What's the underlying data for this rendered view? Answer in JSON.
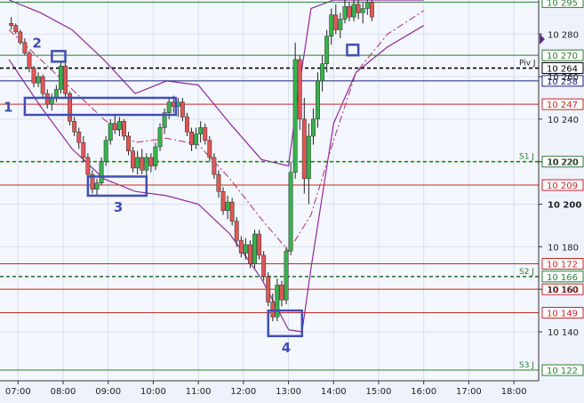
{
  "chart_data": {
    "type": "line",
    "subtype": "candlestick-with-bollinger-bands",
    "title": "",
    "xlabel": "",
    "ylabel": "",
    "x_ticks": [
      "07:00",
      "08:00",
      "09:00",
      "10:00",
      "11:00",
      "12:00",
      "13:00",
      "14:00",
      "15:00",
      "16:00",
      "17:00",
      "18:00"
    ],
    "y_ticks": [
      10140,
      10160,
      10180,
      10200,
      10220,
      10240,
      10260,
      10280
    ],
    "y_tick_labels": [
      "10 140",
      "10 160",
      "10 180",
      "10 200",
      "10 220",
      "10 240",
      "10 260",
      "10 280"
    ],
    "ylim": [
      10117,
      10296
    ],
    "levels": [
      {
        "label": "10 295",
        "value": 10295,
        "color": "#2e7d32",
        "style": "solid"
      },
      {
        "label": "10 270",
        "value": 10270,
        "color": "#2e7d32",
        "style": "solid"
      },
      {
        "label": "10 264",
        "value": 10264,
        "color": "#000000",
        "style": "dashed",
        "name": "Piv J"
      },
      {
        "label": "10 258",
        "value": 10258,
        "color": "#1a237e",
        "style": "solid"
      },
      {
        "label": "10 247",
        "value": 10247,
        "color": "#c62828",
        "style": "solid"
      },
      {
        "label": "10 220",
        "value": 10220,
        "color": "#2e7d32",
        "style": "dashed",
        "name": "S1 J"
      },
      {
        "label": "10 209",
        "value": 10209,
        "color": "#c62828",
        "style": "solid"
      },
      {
        "label": "10 172",
        "value": 10172,
        "color": "#c62828",
        "style": "solid"
      },
      {
        "label": "10 166",
        "value": 10166,
        "color": "#2e7d32",
        "style": "dashed",
        "name": "S2 J"
      },
      {
        "label": "10 160",
        "value": 10160,
        "color": "#c62828",
        "style": "solid"
      },
      {
        "label": "10 149",
        "value": 10149,
        "color": "#c62828",
        "style": "solid"
      },
      {
        "label": "10 122",
        "value": 10122,
        "color": "#2e7d32",
        "style": "solid",
        "name": "S3 J"
      }
    ],
    "series": [
      {
        "values_time": [
          6.8,
          7.0,
          7.2,
          7.4,
          7.6,
          7.8,
          8.0,
          8.2,
          8.4,
          8.6,
          8.8,
          9.0,
          9.2,
          9.4,
          9.6,
          9.8,
          10.0,
          10.2,
          10.4,
          10.6,
          10.8,
          11.0,
          11.2,
          11.4,
          11.6,
          11.8,
          12.0,
          12.2,
          12.4,
          12.6,
          12.8,
          13.0,
          13.2,
          13.4,
          13.6,
          13.8,
          14.0,
          14.2,
          14.4,
          14.6,
          14.8,
          15.0,
          15.2,
          15.4,
          15.6,
          15.8,
          16.0,
          16.2,
          16.4,
          16.6,
          16.8,
          17.0,
          17.2,
          17.4,
          17.6,
          17.8,
          18.0,
          18.2,
          18.4
        ]
      }
    ],
    "candles": [
      [
        6.85,
        10285,
        10288,
        10282,
        10284
      ],
      [
        6.95,
        10284,
        10285,
        10280,
        10281
      ],
      [
        7.05,
        10281,
        10282,
        10275,
        10276
      ],
      [
        7.15,
        10276,
        10278,
        10270,
        10271
      ],
      [
        7.25,
        10271,
        10272,
        10262,
        10264
      ],
      [
        7.35,
        10264,
        10265,
        10255,
        10257
      ],
      [
        7.45,
        10257,
        10262,
        10255,
        10260
      ],
      [
        7.55,
        10260,
        10261,
        10250,
        10252
      ],
      [
        7.65,
        10252,
        10254,
        10245,
        10247
      ],
      [
        7.75,
        10247,
        10252,
        10244,
        10250
      ],
      [
        7.85,
        10250,
        10256,
        10248,
        10254
      ],
      [
        7.95,
        10254,
        10267,
        10252,
        10265
      ],
      [
        8.05,
        10265,
        10267,
        10250,
        10252
      ],
      [
        8.15,
        10252,
        10253,
        10237,
        10239
      ],
      [
        8.25,
        10239,
        10241,
        10232,
        10234
      ],
      [
        8.35,
        10234,
        10236,
        10226,
        10229
      ],
      [
        8.45,
        10229,
        10232,
        10220,
        10222
      ],
      [
        8.55,
        10222,
        10224,
        10212,
        10214
      ],
      [
        8.65,
        10214,
        10216,
        10205,
        10207
      ],
      [
        8.75,
        10207,
        10212,
        10204,
        10210
      ],
      [
        8.85,
        10210,
        10222,
        10209,
        10220
      ],
      [
        8.95,
        10220,
        10232,
        10218,
        10230
      ],
      [
        9.05,
        10230,
        10240,
        10228,
        10238
      ],
      [
        9.15,
        10238,
        10242,
        10233,
        10235
      ],
      [
        9.25,
        10235,
        10241,
        10232,
        10239
      ],
      [
        9.35,
        10239,
        10240,
        10230,
        10232
      ],
      [
        9.45,
        10232,
        10234,
        10223,
        10225
      ],
      [
        9.55,
        10225,
        10227,
        10215,
        10217
      ],
      [
        9.65,
        10217,
        10225,
        10214,
        10222
      ],
      [
        9.75,
        10222,
        10226,
        10214,
        10216
      ],
      [
        9.85,
        10216,
        10224,
        10212,
        10222
      ],
      [
        9.95,
        10222,
        10224,
        10215,
        10218
      ],
      [
        10.05,
        10218,
        10229,
        10216,
        10227
      ],
      [
        10.15,
        10227,
        10238,
        10225,
        10236
      ],
      [
        10.25,
        10236,
        10245,
        10233,
        10243
      ],
      [
        10.35,
        10243,
        10250,
        10240,
        10248
      ],
      [
        10.45,
        10248,
        10251,
        10243,
        10246
      ],
      [
        10.55,
        10246,
        10250,
        10241,
        10248
      ],
      [
        10.65,
        10248,
        10250,
        10239,
        10241
      ],
      [
        10.75,
        10241,
        10243,
        10232,
        10234
      ],
      [
        10.85,
        10234,
        10236,
        10225,
        10228
      ],
      [
        10.95,
        10228,
        10236,
        10226,
        10233
      ],
      [
        11.05,
        10233,
        10239,
        10229,
        10236
      ],
      [
        11.15,
        10236,
        10238,
        10228,
        10230
      ],
      [
        11.25,
        10230,
        10232,
        10220,
        10222
      ],
      [
        11.35,
        10222,
        10224,
        10212,
        10214
      ],
      [
        11.45,
        10214,
        10216,
        10203,
        10206
      ],
      [
        11.55,
        10206,
        10208,
        10195,
        10197
      ],
      [
        11.65,
        10197,
        10204,
        10193,
        10201
      ],
      [
        11.75,
        10201,
        10203,
        10190,
        10192
      ],
      [
        11.85,
        10192,
        10194,
        10180,
        10183
      ],
      [
        11.95,
        10183,
        10185,
        10175,
        10177
      ],
      [
        12.05,
        10177,
        10184,
        10174,
        10181
      ],
      [
        12.15,
        10181,
        10183,
        10170,
        10172
      ],
      [
        12.25,
        10172,
        10188,
        10170,
        10186
      ],
      [
        12.35,
        10186,
        10188,
        10174,
        10176
      ],
      [
        12.45,
        10176,
        10178,
        10164,
        10166
      ],
      [
        12.55,
        10166,
        10168,
        10152,
        10154
      ],
      [
        12.65,
        10154,
        10158,
        10145,
        10147
      ],
      [
        12.75,
        10147,
        10165,
        10145,
        10162
      ],
      [
        12.85,
        10162,
        10164,
        10152,
        10155
      ],
      [
        12.95,
        10155,
        10180,
        10153,
        10178
      ],
      [
        13.05,
        10178,
        10220,
        10176,
        10215
      ],
      [
        13.15,
        10215,
        10276,
        10212,
        10268
      ],
      [
        13.25,
        10268,
        10270,
        10235,
        10240
      ],
      [
        13.35,
        10240,
        10250,
        10205,
        10212
      ],
      [
        13.45,
        10212,
        10238,
        10200,
        10232
      ],
      [
        13.55,
        10232,
        10245,
        10228,
        10240
      ],
      [
        13.65,
        10240,
        10262,
        10236,
        10258
      ],
      [
        13.75,
        10258,
        10270,
        10253,
        10266
      ],
      [
        13.85,
        10266,
        10282,
        10262,
        10279
      ],
      [
        13.95,
        10279,
        10292,
        10275,
        10289
      ],
      [
        14.05,
        10289,
        10294,
        10280,
        10282
      ],
      [
        14.15,
        10282,
        10290,
        10278,
        10287
      ],
      [
        14.25,
        10287,
        10296,
        10285,
        10293
      ],
      [
        14.35,
        10293,
        10295,
        10286,
        10288
      ],
      [
        14.45,
        10288,
        10296,
        10286,
        10294
      ],
      [
        14.55,
        10294,
        10296,
        10287,
        10290
      ],
      [
        14.65,
        10290,
        10295,
        10285,
        10292
      ],
      [
        14.75,
        10292,
        10296,
        10289,
        10295
      ],
      [
        14.85,
        10295,
        10296,
        10286,
        10288
      ]
    ],
    "bollinger": {
      "middle": [
        [
          6.8,
          10282
        ],
        [
          7.5,
          10268
        ],
        [
          8.2,
          10254
        ],
        [
          8.9,
          10240
        ],
        [
          9.6,
          10229
        ],
        [
          10.3,
          10231
        ],
        [
          11.0,
          10228
        ],
        [
          11.7,
          10212
        ],
        [
          12.4,
          10193
        ],
        [
          13.0,
          10178
        ],
        [
          13.5,
          10195
        ],
        [
          14.0,
          10230
        ],
        [
          14.5,
          10262
        ],
        [
          15.2,
          10280
        ],
        [
          16.0,
          10291
        ]
      ],
      "upper": [
        [
          6.8,
          10296
        ],
        [
          7.5,
          10290
        ],
        [
          8.2,
          10282
        ],
        [
          8.9,
          10268
        ],
        [
          9.6,
          10252
        ],
        [
          10.3,
          10258
        ],
        [
          11.0,
          10256
        ],
        [
          11.7,
          10238
        ],
        [
          12.4,
          10221
        ],
        [
          13.0,
          10218
        ],
        [
          13.2,
          10250
        ],
        [
          13.5,
          10292
        ],
        [
          14.0,
          10296
        ],
        [
          15.0,
          10296
        ],
        [
          16.0,
          10296
        ]
      ],
      "lower": [
        [
          6.8,
          10268
        ],
        [
          7.5,
          10246
        ],
        [
          8.2,
          10226
        ],
        [
          8.9,
          10212
        ],
        [
          9.6,
          10206
        ],
        [
          10.3,
          10204
        ],
        [
          11.0,
          10200
        ],
        [
          11.7,
          10186
        ],
        [
          12.4,
          10165
        ],
        [
          13.0,
          10141
        ],
        [
          13.3,
          10140
        ],
        [
          13.5,
          10170
        ],
        [
          14.0,
          10238
        ],
        [
          14.5,
          10262
        ],
        [
          15.2,
          10274
        ],
        [
          16.0,
          10284
        ]
      ]
    },
    "annotations": [
      {
        "label": "1",
        "box_time": [
          7.15,
          10.5
        ],
        "box_price": [
          10242,
          10250
        ]
      },
      {
        "label": "2",
        "box_time": [
          7.75,
          8.05
        ],
        "box_price": [
          10267,
          10272
        ]
      },
      {
        "label": "3",
        "box_time": [
          8.55,
          9.85
        ],
        "box_price": [
          10204,
          10213
        ]
      },
      {
        "label": "4",
        "box_time": [
          12.55,
          13.3
        ],
        "box_price": [
          10138,
          10150
        ]
      },
      {
        "label": "",
        "box_time": [
          14.3,
          14.55
        ],
        "box_price": [
          10270,
          10275
        ]
      }
    ]
  }
}
